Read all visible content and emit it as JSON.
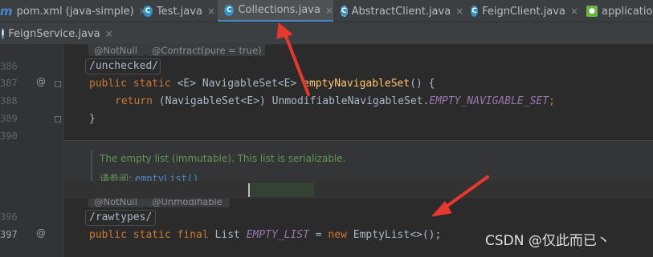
{
  "tabs_row1": [
    {
      "label": "pom.xml (java-simple)",
      "icon": "maven-icon",
      "active": false
    },
    {
      "label": "Test.java",
      "icon": "class-icon",
      "active": false
    },
    {
      "label": "Collections.java",
      "icon": "class-icon",
      "active": true
    },
    {
      "label": "AbstractClient.java",
      "icon": "abstract-class-icon",
      "active": false
    },
    {
      "label": "FeignClient.java",
      "icon": "class-icon",
      "active": false
    },
    {
      "label": "application",
      "icon": "spring-config-icon",
      "active": false
    }
  ],
  "tabs_row2": [
    {
      "label": "FeignService.java",
      "icon": "interface-icon",
      "active": false
    }
  ],
  "close_glyph": "×",
  "gutter": {
    "lines": [
      "386",
      "387",
      "388",
      "389",
      "390",
      "396",
      "397"
    ],
    "override_marker": "@"
  },
  "hints": {
    "notnull": "@NotNull",
    "contract": "@Contract(pure = true)",
    "unmodifiable": "@Unmodifiable"
  },
  "code": {
    "raw_unchecked": "/unchecked/",
    "l387_a": "public static ",
    "l387_b": "<E> NavigableSet<E> ",
    "l387_fn": "emptyNavigableSet",
    "l387_c": "() {",
    "l388_kw": "return ",
    "l388_a": "(NavigableSet<E>) UnmodifiableNavigableSet.",
    "l388_const": "EMPTY_NAVIGABLE_SET",
    "l388_end": ";",
    "l389": "}",
    "raw_rawtypes": "/rawtypes/",
    "l397_kw": "public static final ",
    "l397_a": "List ",
    "l397_const": "EMPTY_LIST",
    "l397_b": " = ",
    "l397_new": "new ",
    "l397_c": "EmptyList<>();"
  },
  "doc": {
    "text": "The empty list (immutable). This list is serializable.",
    "see_label": "请参阅: ",
    "see_link": "emptyList()"
  },
  "watermark": "CSDN @仅此而已丶",
  "colors": {
    "accent": "#4a88c7",
    "keyword": "#cc7832",
    "method": "#ffc66d",
    "constant": "#9876aa",
    "doc": "#629755",
    "arrow": "#e8382e"
  }
}
